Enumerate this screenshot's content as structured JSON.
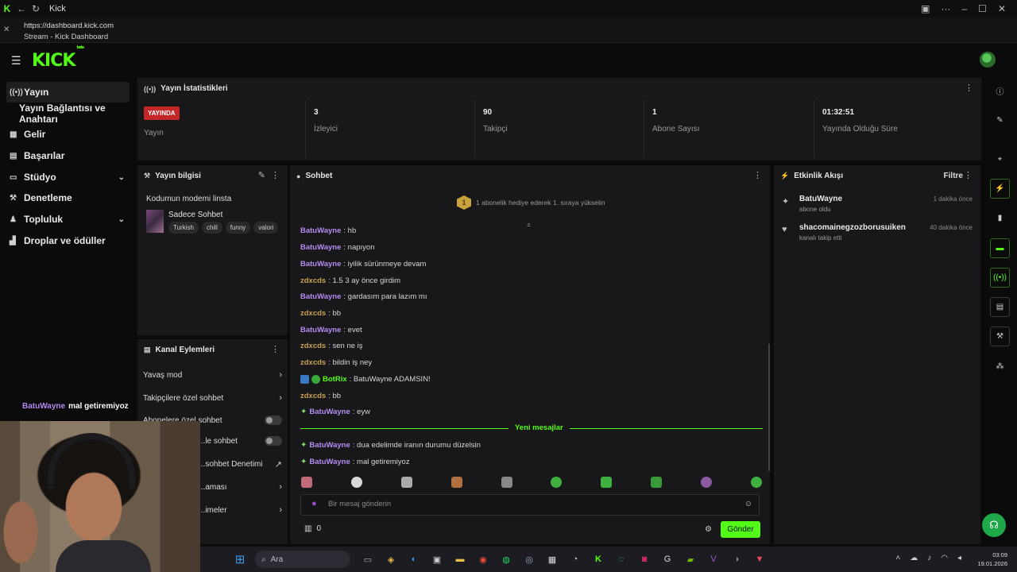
{
  "browser": {
    "tab_title": "Kick",
    "url": "https://dashboard.kick.com",
    "page_title": "Stream - Kick Dashboard"
  },
  "app": {
    "logo": "KICK",
    "logo_sup": "beta"
  },
  "nav": {
    "items": [
      {
        "label": "Yayın",
        "icon": "broadcast-icon"
      },
      {
        "label": "Yayın Bağlantısı ve Anahtarı"
      },
      {
        "label": "Gelir",
        "icon": "revenue-icon"
      },
      {
        "label": "Başarılar",
        "icon": "achievements-icon"
      },
      {
        "label": "Stüdyo",
        "icon": "studio-icon"
      },
      {
        "label": "Denetleme",
        "icon": "moderation-icon"
      },
      {
        "label": "Topluluk",
        "icon": "community-icon"
      },
      {
        "label": "Droplar ve ödüller",
        "icon": "drops-icon"
      }
    ]
  },
  "stats": {
    "title": "Yayın İstatistikleri",
    "live_badge": "YAYINDA",
    "live_label": "Yayın",
    "viewers": {
      "value": "3",
      "label": "İzleyici"
    },
    "followers": {
      "value": "90",
      "label": "Takipçi"
    },
    "subs": {
      "value": "1",
      "label": "Abone Sayısı"
    },
    "uptime": {
      "value": "01:32:51",
      "label": "Yayında Olduğu Süre"
    }
  },
  "stream_info": {
    "title": "Yayın bilgisi",
    "stream_title": "Kodumun modemi linsta",
    "category": "Sadece Sohbet",
    "tags": [
      "Turkish",
      "chill",
      "funny",
      "valori"
    ]
  },
  "channel_actions": {
    "title": "Kanal Eylemleri",
    "rows": [
      "Yavaş mod",
      "Takipçilere özel sohbet",
      "Abonelere özel sohbet",
      "...le sohbet",
      "...sohbet Denetimi",
      "...aması",
      "...imeler"
    ]
  },
  "chat": {
    "title": "Sohbet",
    "pinned_text": "1 abonelik hediye ederek 1. sıraya yükselin",
    "pinned_badge": "1",
    "messages": [
      {
        "user": "BatuWayne",
        "text": ": hb"
      },
      {
        "user": "BatuWayne",
        "text": ": napıyon"
      },
      {
        "user": "BatuWayne",
        "text": ": iyilik sürünmeye devam"
      },
      {
        "user": "zdxcds",
        "text": ": 1.5 3 ay önce girdim"
      },
      {
        "user": "BatuWayne",
        "text": ": gardasım para lazım mı"
      },
      {
        "user": "zdxcds",
        "text": ": bb"
      },
      {
        "user": "BatuWayne",
        "text": ": evet"
      },
      {
        "user": "zdxcds",
        "text": ": sen ne iş"
      },
      {
        "user": "zdxcds",
        "text": ": bildin iş ney"
      },
      {
        "user": "BotRix",
        "text": ": BatuWayne ADAMSIN!"
      },
      {
        "user": "zdxcds",
        "text": ": bb"
      },
      {
        "user": "BatuWayne",
        "text": ": eyw"
      },
      {
        "user": "BatuWayne",
        "text": ": dua edelimde iranın durumu düzelsin"
      },
      {
        "user": "BatuWayne",
        "text": ": mal getiremiyoz"
      }
    ],
    "new_messages_label": "Yeni mesajlar",
    "input_placeholder": "Bir mesaj gönderin",
    "points": "0",
    "send_label": "Gönder"
  },
  "activity": {
    "title": "Etkinlik Akışı",
    "filter": "Filtre",
    "events": [
      {
        "name": "BatuWayne",
        "desc": "abone oldu",
        "time": "1 dakika önce"
      },
      {
        "name": "shacomainegzozborusuiken",
        "desc": "kanalı takip etti",
        "time": "40 dakika önce"
      }
    ]
  },
  "webcam_caption": {
    "user": "BatuWayne",
    "text": "mal getiremiyoz"
  },
  "taskbar": {
    "search": "Ara",
    "time": "03:09",
    "date": "19.01.2026"
  },
  "colors": {
    "accent": "#53fc18",
    "live": "#c42727",
    "username": "#b48cf0"
  }
}
